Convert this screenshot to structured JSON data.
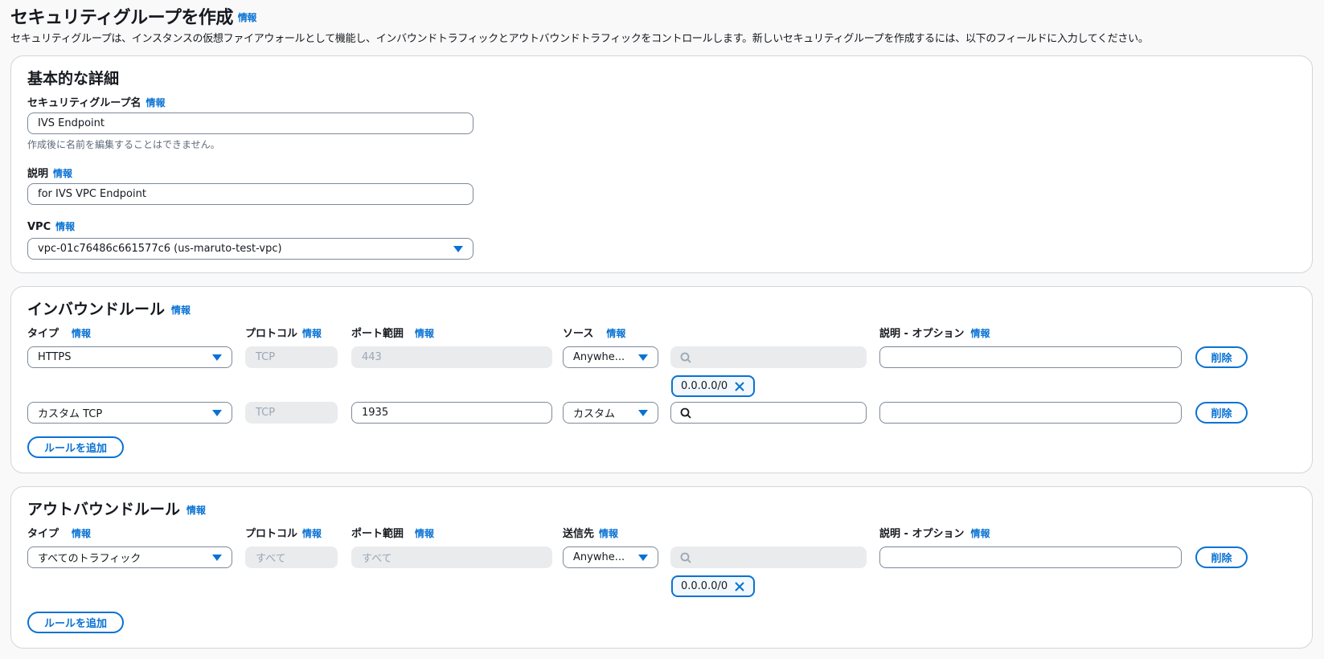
{
  "page": {
    "title": "セキュリティグループを作成",
    "info": "情報",
    "description": "セキュリティグループは、インスタンスの仮想ファイアウォールとして機能し、インバウンドトラフィックとアウトバウンドトラフィックをコントロールします。新しいセキュリティグループを作成するには、以下のフィールドに入力してください。"
  },
  "basic": {
    "title": "基本的な詳細",
    "name_label": "セキュリティグループ名",
    "name_value": "IVS Endpoint",
    "name_hint": "作成後に名前を編集することはできません。",
    "desc_label": "説明",
    "desc_value": "for IVS VPC Endpoint",
    "vpc_label": "VPC",
    "vpc_value": "vpc-01c76486c661577c6 (us-maruto-test-vpc)"
  },
  "inbound": {
    "title": "インバウンドルール",
    "headers": {
      "type": "タイプ",
      "protocol": "プロトコル",
      "port": "ポート範囲",
      "source": "ソース",
      "desc": "説明 - オプション"
    },
    "rows": [
      {
        "type": "HTTPS",
        "protocol": "TCP",
        "port": "443",
        "source": "Anywhe...",
        "search": "",
        "token": "0.0.0.0/0",
        "desc": "",
        "delete": "削除"
      },
      {
        "type": "カスタム TCP",
        "protocol": "TCP",
        "port": "1935",
        "source": "カスタム",
        "search": "",
        "desc": "",
        "delete": "削除"
      }
    ],
    "add_rule": "ルールを追加"
  },
  "outbound": {
    "title": "アウトバウンドルール",
    "headers": {
      "type": "タイプ",
      "protocol": "プロトコル",
      "port": "ポート範囲",
      "dest": "送信先",
      "desc": "説明 - オプション"
    },
    "rows": [
      {
        "type": "すべてのトラフィック",
        "protocol": "すべて",
        "port": "すべて",
        "dest": "Anywhe...",
        "search": "",
        "token": "0.0.0.0/0",
        "desc": "",
        "delete": "削除"
      }
    ],
    "add_rule": "ルールを追加"
  },
  "colors": {
    "accent": "#0972d3",
    "border": "#7d8998",
    "disabled_bg": "#e9ebed"
  },
  "icons": {
    "dropdown": "caret-down-icon",
    "search": "search-icon",
    "remove": "close-icon"
  }
}
